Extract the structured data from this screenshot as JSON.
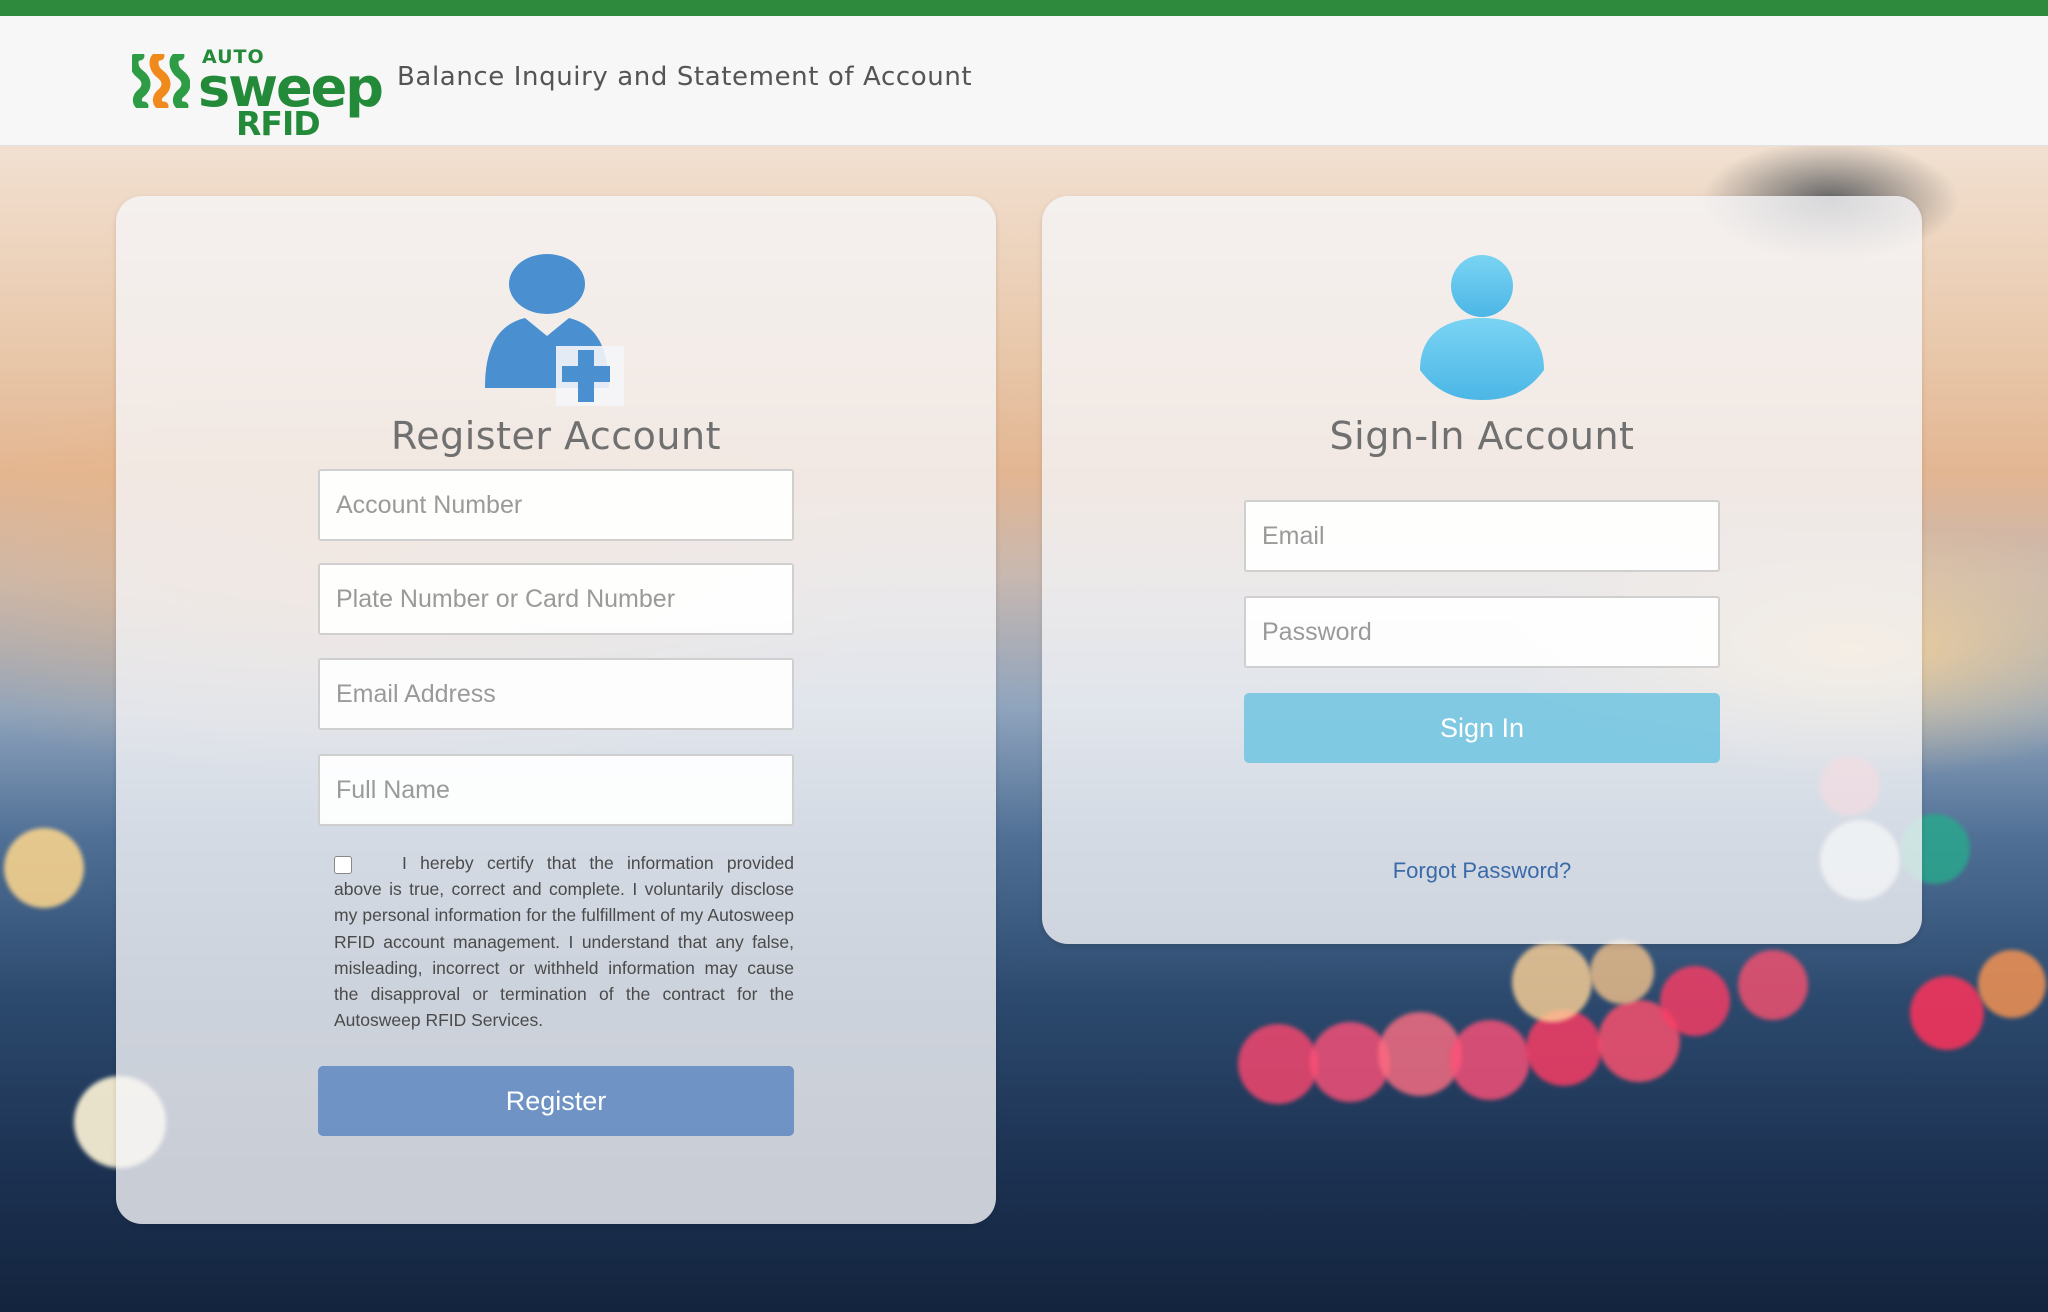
{
  "header": {
    "title": "Balance Inquiry and Statement of Account",
    "logo": {
      "auto": "AUTO",
      "sweep": "sweep",
      "rfid": "RFID"
    }
  },
  "colors": {
    "brand_green": "#2e8b3e",
    "register_blue": "#4a90d0",
    "signin_blue": "#5ec2ea",
    "link_blue": "#3a6aa8"
  },
  "register": {
    "title": "Register Account",
    "icon": "add-user-icon",
    "fields": {
      "account_number": {
        "value": "",
        "placeholder": "Account Number"
      },
      "plate_or_card": {
        "value": "",
        "placeholder": "Plate Number or Card Number"
      },
      "email": {
        "value": "",
        "placeholder": "Email Address"
      },
      "full_name": {
        "value": "",
        "placeholder": "Full Name"
      }
    },
    "certify_checked": false,
    "certify_text": "I hereby certify that the information provided above is true, correct and complete. I voluntarily disclose my personal information for the fulfillment of my Autosweep RFID account management. I understand that any false, misleading, incorrect or withheld information may cause the disapproval or termination of the contract for the Autosweep RFID Services.",
    "button_label": "Register"
  },
  "signin": {
    "title": "Sign-In Account",
    "icon": "user-icon",
    "fields": {
      "email": {
        "value": "",
        "placeholder": "Email"
      },
      "password": {
        "value": "",
        "placeholder": "Password"
      }
    },
    "button_label": "Sign In",
    "forgot_label": "Forgot Password?"
  }
}
